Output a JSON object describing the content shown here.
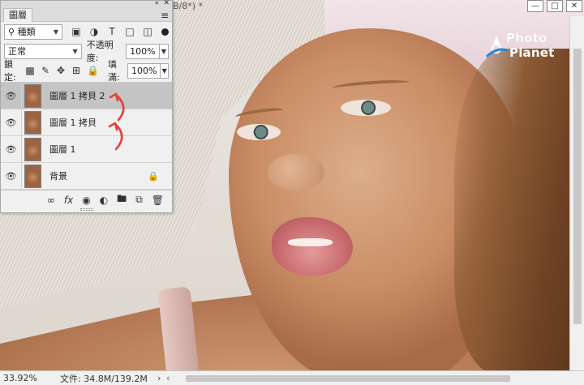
{
  "document": {
    "title_fragment": "B/8*) *"
  },
  "watermark": {
    "line1": "Photo",
    "line2": "Planet"
  },
  "panel": {
    "tab": "圖層",
    "filter_kind": "種類",
    "blend_mode": "正常",
    "opacity_label": "不透明度:",
    "opacity": "100%",
    "lock_label": "鎖定:",
    "fill_label": "填滿:",
    "fill": "100%"
  },
  "layers": [
    {
      "name": "圖層 1 拷貝 2",
      "selected": true
    },
    {
      "name": "圖層 1 拷貝",
      "selected": false
    },
    {
      "name": "圖層 1",
      "selected": false
    },
    {
      "name": "背景",
      "selected": false,
      "locked": true
    }
  ],
  "status": {
    "zoom": "33.92%",
    "file_label": "文件:",
    "file_size": "34.8M/139.2M"
  },
  "colors": {
    "annotation_arrow": "#e0443a",
    "selected_layer": "#c4c4c4",
    "panel_bg": "#f0f0f0"
  }
}
